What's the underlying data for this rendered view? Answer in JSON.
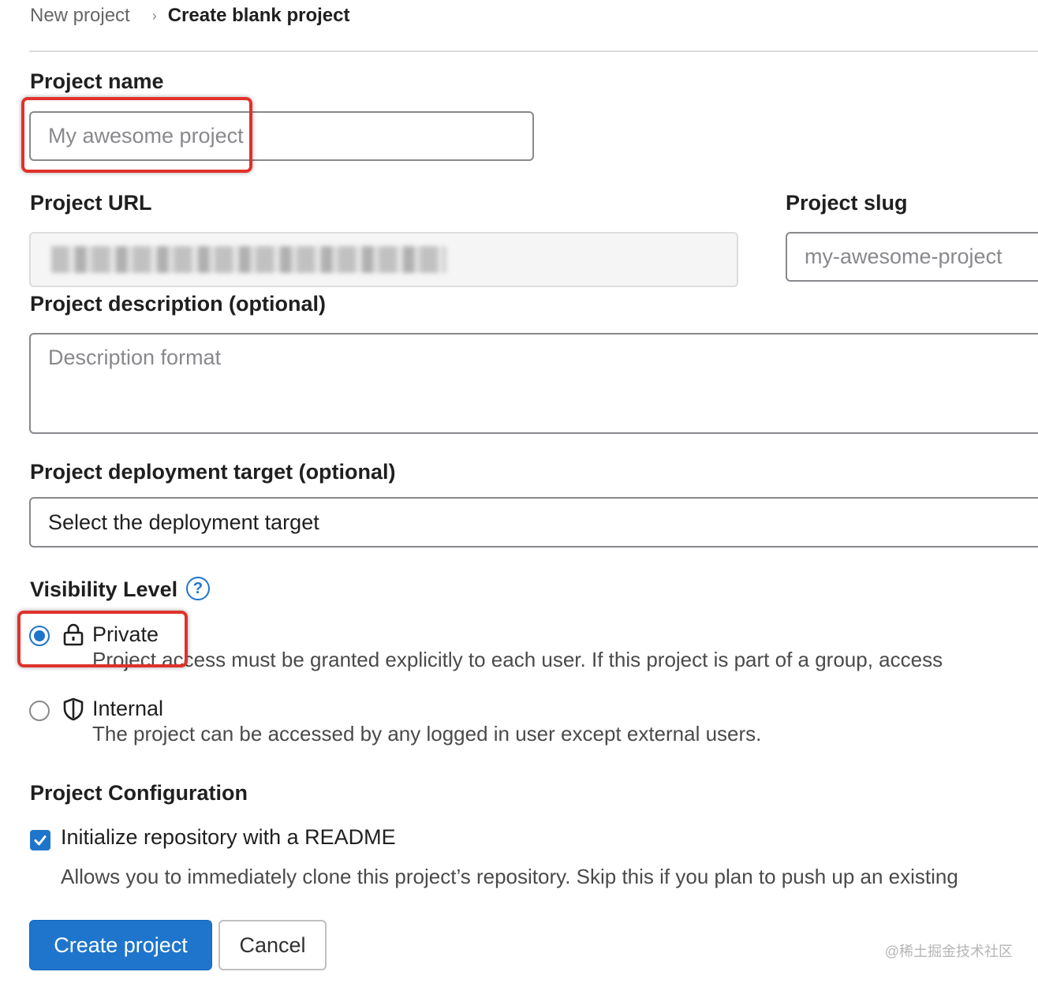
{
  "breadcrumb": {
    "parent": "New project",
    "separator": "›",
    "current": "Create blank project"
  },
  "form": {
    "project_name": {
      "label": "Project name",
      "placeholder": "My awesome project"
    },
    "project_url": {
      "label": "Project URL"
    },
    "project_slug": {
      "label": "Project slug",
      "placeholder": "my-awesome-project"
    },
    "description": {
      "label": "Project description (optional)",
      "placeholder": "Description format"
    },
    "deployment_target": {
      "label": "Project deployment target (optional)",
      "selected": "Select the deployment target"
    },
    "visibility": {
      "label": "Visibility Level",
      "help_icon": "?",
      "options": [
        {
          "title": "Private",
          "description": "Project access must be granted explicitly to each user. If this project is part of a group, access",
          "icon": "lock-icon",
          "checked": true
        },
        {
          "title": "Internal",
          "description": "The project can be accessed by any logged in user except external users.",
          "icon": "shield-icon",
          "checked": false
        }
      ]
    },
    "configuration": {
      "label": "Project Configuration",
      "readme_checkbox": {
        "label": "Initialize repository with a README",
        "help": "Allows you to immediately clone this project’s repository. Skip this if you plan to push up an existing",
        "checked": true
      }
    }
  },
  "buttons": {
    "create": "Create project",
    "cancel": "Cancel"
  },
  "watermark": "@稀土掘金技术社区",
  "colors": {
    "primary": "#1f75cb",
    "highlight": "#e0322b",
    "border": "#89888d"
  }
}
